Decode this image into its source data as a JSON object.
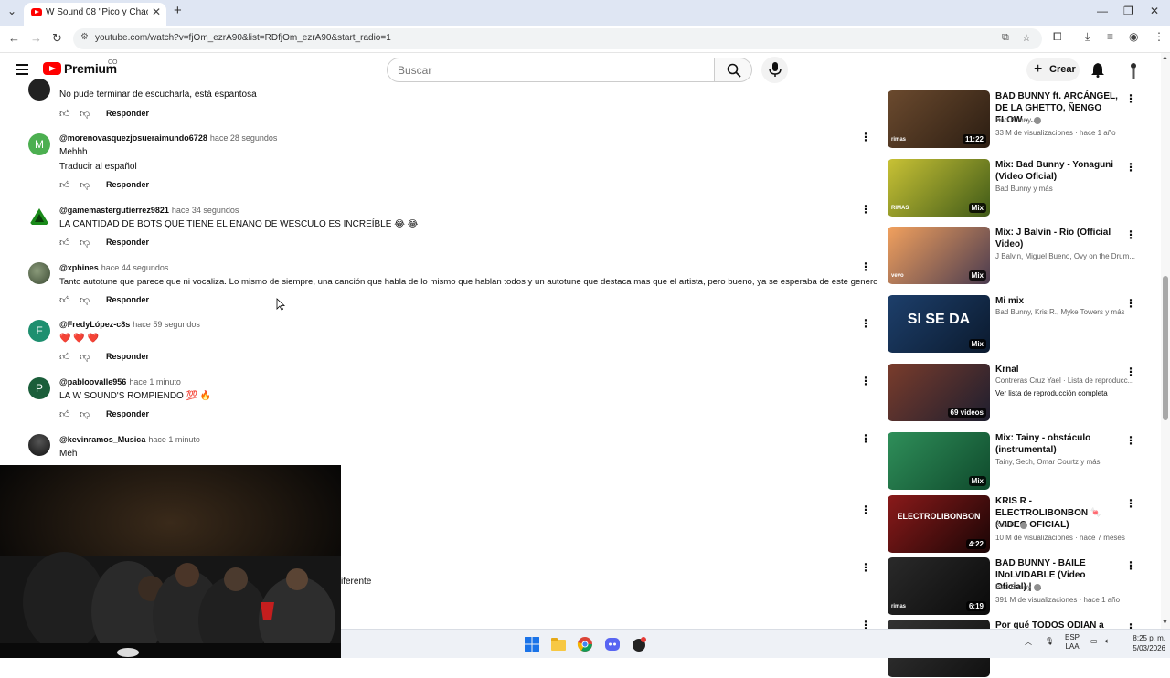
{
  "browser": {
    "tab_title": "W Sound 08 \"Pico y Chao\" - Kri",
    "new_tab": "+",
    "url": "youtube.com/watch?v=fjOm_ezrA90&list=RDfjOm_ezrA90&start_radio=1"
  },
  "header": {
    "logo_text": "Premium",
    "country": "CO",
    "search_placeholder": "Buscar",
    "create_label": "Crear"
  },
  "comments": [
    {
      "text": "No pude terminar de escucharla, está espantosa",
      "reply": "Responder"
    },
    {
      "avatar_letter": "M",
      "avatar_color": "#4caf50",
      "user": "@morenovasquezjosueraimundo6728",
      "time": "hace 28 segundos",
      "text": "Mehhh",
      "translate": "Traducir al español",
      "reply": "Responder"
    },
    {
      "user": "@gamemastergutierrez9821",
      "time": "hace 34 segundos",
      "text": "LA CANTIDAD DE BOTS QUE TIENE EL ENANO DE WESCULO ES INCREÍBLE 😂 😂",
      "reply": "Responder"
    },
    {
      "user": "@xphines",
      "time": "hace 44 segundos",
      "text": "Tanto autotune que parece que ni vocaliza. Lo mismo de siempre, una canción que habla de lo mismo que hablan todos y un autotune que destaca mas que el artista, pero bueno, ya se esperaba de este genero",
      "reply": "Responder"
    },
    {
      "avatar_letter": "F",
      "avatar_color": "#1e8f6f",
      "user": "@FredyLópez-c8s",
      "time": "hace 59 segundos",
      "text": "❤️ ❤️ ❤️",
      "reply": "Responder"
    },
    {
      "avatar_letter": "P",
      "avatar_color": "#1b5e3a",
      "user": "@pabloovalle956",
      "time": "hace 1 minuto",
      "text": "LA W SOUND'S ROMPIENDO 💯 🔥",
      "reply": "Responder"
    },
    {
      "user": "@kevinramos_Musica",
      "time": "hace 1 minuto",
      "text": "Meh"
    }
  ],
  "partial_text": "iferente",
  "sidebar": [
    {
      "title": "BAD BUNNY ft. ARCÁNGEL, DE LA GHETTO, ÑENGO FLOW - ...",
      "channel": "Bad Bunny",
      "verified": true,
      "meta": "33 M de visualizaciones · hace 1 año",
      "badge": "11:22",
      "brand": "rimas",
      "c1": "#6b4a2e",
      "c2": "#2b1d12"
    },
    {
      "title": "Mix: Bad Bunny - Yonaguni (Video Oficial)",
      "channel": "Bad Bunny y más",
      "badge": "Mix",
      "brand": "RIMAS",
      "c1": "#c9c235",
      "c2": "#3f5a18"
    },
    {
      "title": "Mix: J Balvin - Rio (Official Video)",
      "channel": "J Balvin, Miguel Bueno, Ovy on the Drum...",
      "badge": "Mix",
      "brand": "vevo",
      "c1": "#f2a15e",
      "c2": "#4a3b4f"
    },
    {
      "title": "Mi mix",
      "channel": "Bad Bunny, Kris R., Myke Towers y más",
      "badge": "Mix",
      "overlay": "SI SE DA",
      "c1": "#1d3f6b",
      "c2": "#0b1a2e"
    },
    {
      "title": "Krnal",
      "channel": "Contreras Cruz Yael · Lista de reproducc...",
      "link": "Ver lista de reproducción completa",
      "badge": "69 videos",
      "c1": "#7a3c2c",
      "c2": "#1e1e2e"
    },
    {
      "title": "Mix: Tainy - obstáculo (instrumental)",
      "channel": "Tainy, Sech, Omar Courtz y más",
      "badge": "Mix",
      "c1": "#2f8f5a",
      "c2": "#0f4a2c"
    },
    {
      "title": "KRIS R - ELECTROLIBONBON 🍬 (VIDEO OFICIAL)",
      "channel": "Kris R.",
      "verified": true,
      "meta": "10 M de visualizaciones · hace 7 meses",
      "badge": "4:22",
      "overlay": "ELECTROLIBONBON",
      "c1": "#8a1a1a",
      "c2": "#1a0505"
    },
    {
      "title": "BAD BUNNY - BAILE INoLVIDABLE (Video Oficial) | ...",
      "channel": "Bad Bunny",
      "verified": true,
      "meta": "391 M de visualizaciones · hace 1 año",
      "badge": "6:19",
      "brand": "rimas",
      "c1": "#2a2a2a",
      "c2": "#0a0a0a"
    },
    {
      "title": "Por qué TODOS ODIAN a MR ...",
      "c1": "#333",
      "c2": "#111"
    }
  ],
  "taskbar": {
    "lang1": "ESP",
    "lang2": "LAA",
    "time": "8:25 p. m.",
    "date": "5/03/2026"
  },
  "colors": {
    "youtube_red": "#ff0000",
    "tab_strip": "#dfe6f3"
  }
}
